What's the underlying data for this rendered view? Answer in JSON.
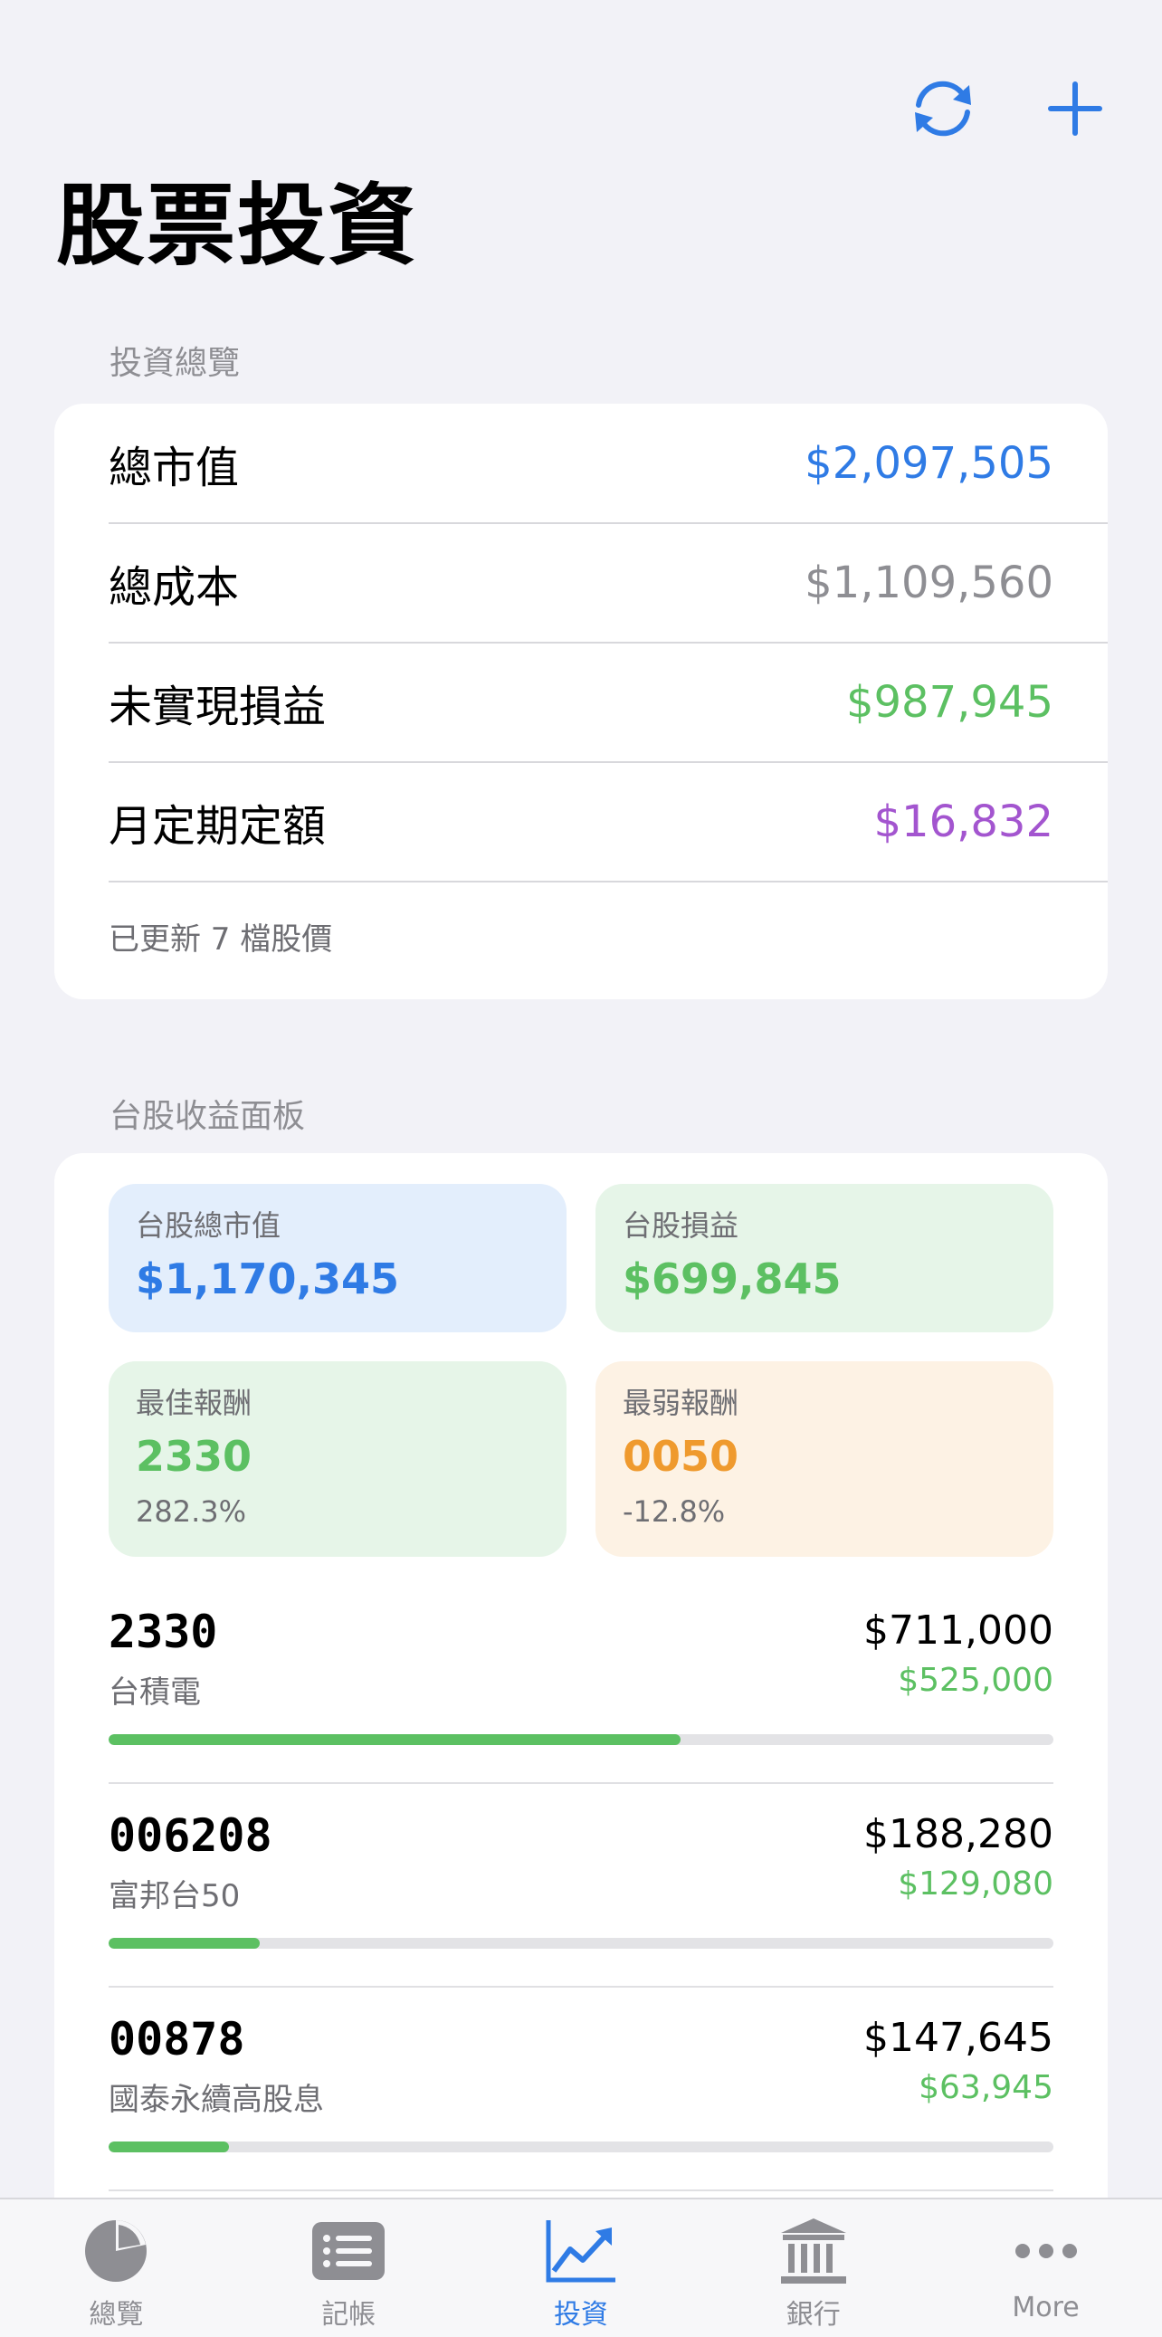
{
  "colors": {
    "accent_blue": "#2f7be5",
    "gray_value": "#8e8e93",
    "green": "#5cc062",
    "purple": "#a355cf",
    "orange": "#ef9a2e",
    "tile_blue_bg": "#e3eefc",
    "tile_green_bg": "#e6f5e8",
    "tile_orange_bg": "#fdf2e4"
  },
  "nav": {
    "refresh_icon": "arrow-circle-refresh",
    "add_icon": "plus"
  },
  "page": {
    "title": "股票投資"
  },
  "overview": {
    "header": "投資總覽",
    "rows": [
      {
        "label": "總市值",
        "value": "$2,097,505",
        "color": "#2f7be5"
      },
      {
        "label": "總成本",
        "value": "$1,109,560",
        "color": "#8e8e93"
      },
      {
        "label": "未實現損益",
        "value": "$987,945",
        "color": "#5cc062"
      },
      {
        "label": "月定期定額",
        "value": "$16,832",
        "color": "#a355cf"
      }
    ],
    "footnote": "已更新 7 檔股價"
  },
  "tw_panel": {
    "header": "台股收益面板",
    "tiles": {
      "market_value": {
        "label": "台股總市值",
        "value": "$1,170,345"
      },
      "profit": {
        "label": "台股損益",
        "value": "$699,845"
      },
      "best": {
        "label": "最佳報酬",
        "value": "2330",
        "sub": "282.3%"
      },
      "worst": {
        "label": "最弱報酬",
        "value": "0050",
        "sub": "-12.8%"
      }
    },
    "stocks": [
      {
        "code": "2330",
        "name": "台積電",
        "market_value": "$711,000",
        "profit": "$525,000",
        "progress": 0.605
      },
      {
        "code": "006208",
        "name": "富邦台50",
        "market_value": "$188,280",
        "profit": "$129,080",
        "progress": 0.16
      },
      {
        "code": "00878",
        "name": "國泰永續高股息",
        "market_value": "$147,645",
        "profit": "$63,945",
        "progress": 0.127
      }
    ]
  },
  "tabbar": {
    "tabs": [
      {
        "label": "總覽",
        "icon": "pie-chart-icon",
        "active": false
      },
      {
        "label": "記帳",
        "icon": "list-icon",
        "active": false
      },
      {
        "label": "投資",
        "icon": "trend-up-icon",
        "active": true
      },
      {
        "label": "銀行",
        "icon": "bank-icon",
        "active": false
      },
      {
        "label": "More",
        "icon": "more-icon",
        "active": false
      }
    ]
  }
}
